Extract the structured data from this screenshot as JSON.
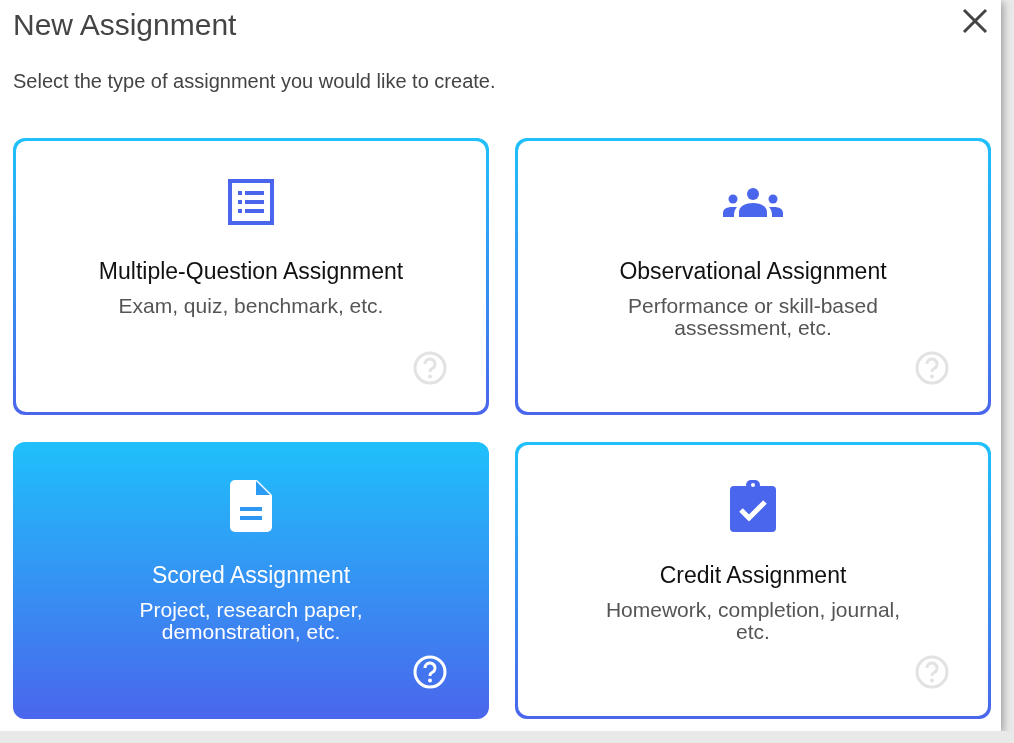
{
  "dialog": {
    "title": "New Assignment",
    "subtitle": "Select the type of assignment you would like to create."
  },
  "options": [
    {
      "kind": "list",
      "title": "Multiple-Question Assignment",
      "description": "Exam, quiz, benchmark, etc.",
      "selected": false
    },
    {
      "kind": "group",
      "title": "Observational Assignment",
      "description": "Performance or skill-based assessment, etc.",
      "selected": false
    },
    {
      "kind": "document",
      "title": "Scored Assignment",
      "description": "Project, research paper, demonstration, etc.",
      "selected": true
    },
    {
      "kind": "clipboard",
      "title": "Credit Assignment",
      "description": "Homework, completion, journal, etc.",
      "selected": false
    }
  ]
}
